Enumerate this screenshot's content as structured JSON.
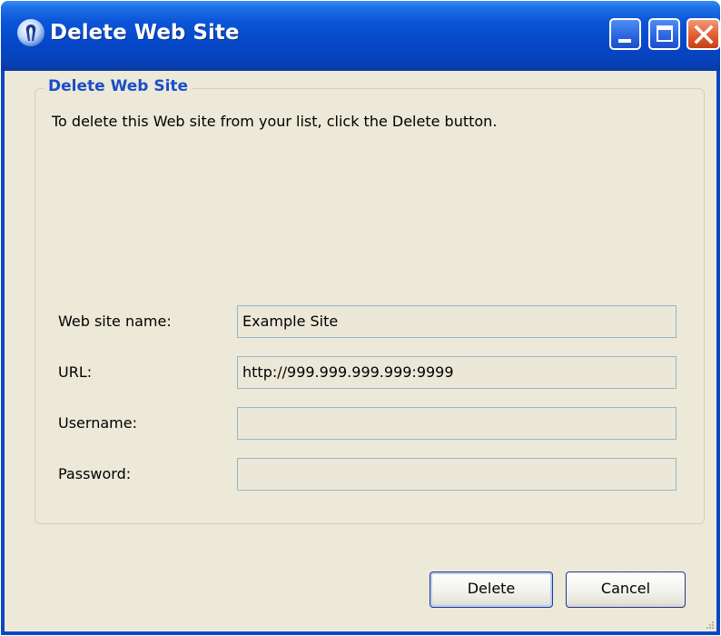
{
  "window": {
    "title": "Delete Web Site",
    "app_icon": "app-logo-icon",
    "controls": [
      "minimize-icon",
      "maximize-icon",
      "close-icon"
    ]
  },
  "group": {
    "title": "Delete Web Site",
    "instructions": "To delete this Web site from your list, click the Delete button."
  },
  "fields": {
    "name": {
      "label": "Web site name:",
      "value": "Example Site"
    },
    "url": {
      "label": "URL:",
      "value": "http://999.999.999.999:9999"
    },
    "username": {
      "label": "Username:",
      "value": ""
    },
    "password": {
      "label": "Password:",
      "value": ""
    }
  },
  "buttons": {
    "delete": "Delete",
    "cancel": "Cancel"
  },
  "colors": {
    "titlebar": "#0a54d8",
    "face": "#ece9d8",
    "group_title": "#1a4ec9",
    "close": "#e25c30"
  }
}
